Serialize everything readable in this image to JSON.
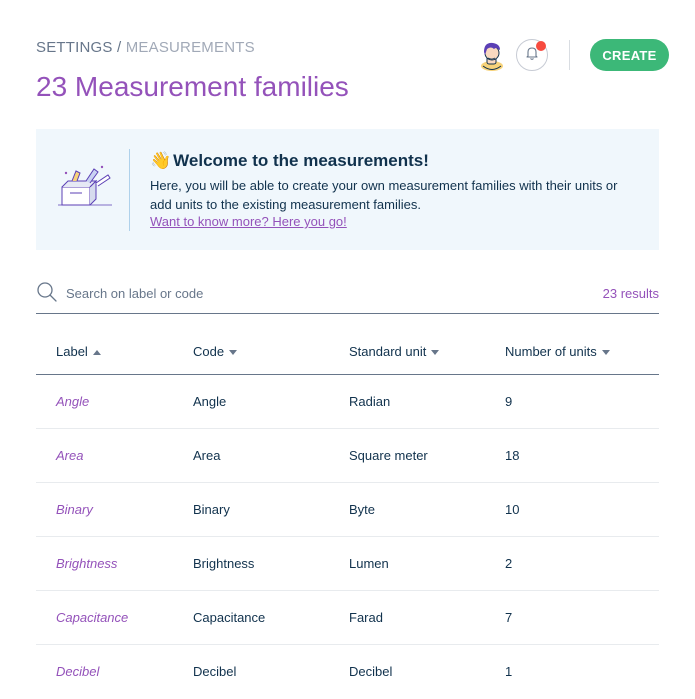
{
  "breadcrumb": {
    "settings": "SETTINGS",
    "separator": " / ",
    "current": "MEASUREMENTS"
  },
  "page_title": "23 Measurement families",
  "header": {
    "avatar_icon": "user-avatar-icon",
    "bell_icon": "bell-icon",
    "create_label": "CREATE"
  },
  "helper": {
    "emoji": "👋",
    "title": "Welcome to the measurements!",
    "body": "Here, you will be able to create your own measurement families with their units or add units to the existing measurement families.",
    "link": "Want to know more? Here you go!"
  },
  "search": {
    "placeholder": "Search on label or code",
    "value": "",
    "results": "23 results"
  },
  "table": {
    "headers": [
      "Label",
      "Code",
      "Standard unit",
      "Number of units"
    ],
    "rows": [
      [
        "Angle",
        "Angle",
        "Radian",
        "9"
      ],
      [
        "Area",
        "Area",
        "Square meter",
        "18"
      ],
      [
        "Binary",
        "Binary",
        "Byte",
        "10"
      ],
      [
        "Brightness",
        "Brightness",
        "Lumen",
        "2"
      ],
      [
        "Capacitance",
        "Capacitance",
        "Farad",
        "7"
      ],
      [
        "Decibel",
        "Decibel",
        "Decibel",
        "1"
      ]
    ]
  },
  "colors": {
    "accent": "#9452ba",
    "create": "#3cb878",
    "notification": "#f74b3f",
    "text": "#11324d",
    "helper_bg": "#f0f7fc"
  }
}
